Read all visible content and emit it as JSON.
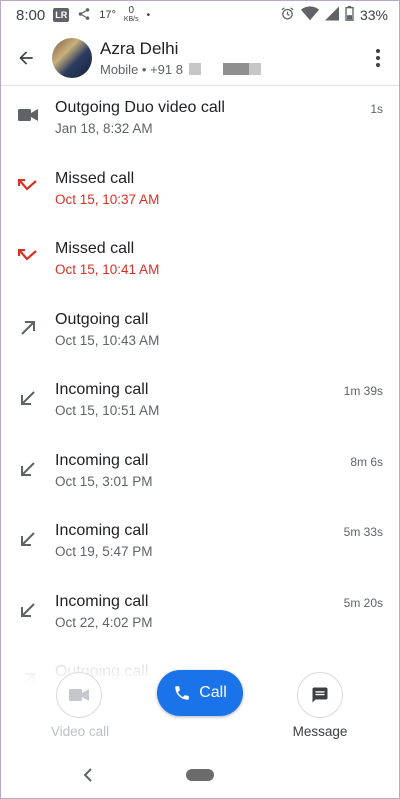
{
  "status_bar": {
    "time": "8:00",
    "lr_badge": "LR",
    "temperature": "17°",
    "speed_value": "0",
    "speed_unit": "KB/s",
    "dot": "•",
    "battery_percent": "33%"
  },
  "header": {
    "contact_name": "Azra Delhi",
    "contact_sub": "Mobile • +91 8"
  },
  "calls": [
    {
      "type": "Outgoing Duo video call",
      "time": "Jan 18, 8:32 AM",
      "duration": "1s",
      "icon": "videocam-icon",
      "missed": false
    },
    {
      "type": "Missed call",
      "time": "Oct 15, 10:37 AM",
      "duration": "",
      "icon": "missed-call-icon",
      "missed": true
    },
    {
      "type": "Missed call",
      "time": "Oct 15, 10:41 AM",
      "duration": "",
      "icon": "missed-call-icon",
      "missed": true
    },
    {
      "type": "Outgoing call",
      "time": "Oct 15, 10:43 AM",
      "duration": "",
      "icon": "outgoing-call-icon",
      "missed": false
    },
    {
      "type": "Incoming call",
      "time": "Oct 15, 10:51 AM",
      "duration": "1m 39s",
      "icon": "incoming-call-icon",
      "missed": false
    },
    {
      "type": "Incoming call",
      "time": "Oct 15, 3:01 PM",
      "duration": "8m 6s",
      "icon": "incoming-call-icon",
      "missed": false
    },
    {
      "type": "Incoming call",
      "time": "Oct 19, 5:47 PM",
      "duration": "5m 33s",
      "icon": "incoming-call-icon",
      "missed": false
    },
    {
      "type": "Incoming call",
      "time": "Oct 22, 4:02 PM",
      "duration": "5m 20s",
      "icon": "incoming-call-icon",
      "missed": false
    },
    {
      "type": "Outgoing call",
      "time": "",
      "duration": "",
      "icon": "outgoing-call-icon",
      "missed": false
    }
  ],
  "actions": {
    "video_label": "Video call",
    "call_label": "Call",
    "message_label": "Message"
  },
  "colors": {
    "accent": "#1a73e8",
    "missed": "#d93025",
    "icon_gray": "#5f6368"
  }
}
